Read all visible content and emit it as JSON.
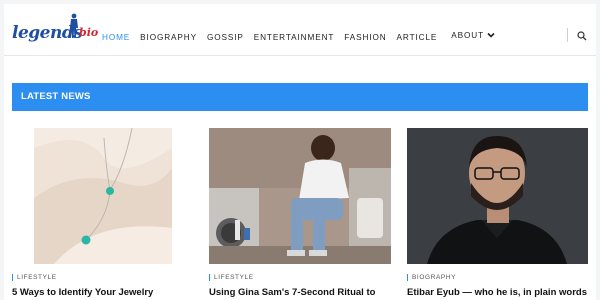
{
  "header": {
    "logo": {
      "word": "legends",
      "suffix": "bio"
    },
    "nav": [
      {
        "label": "HOME",
        "active": true
      },
      {
        "label": "BIOGRAPHY",
        "active": false
      },
      {
        "label": "GOSSIP",
        "active": false
      },
      {
        "label": "ENTERTAINMENT",
        "active": false
      },
      {
        "label": "FASHION",
        "active": false
      },
      {
        "label": "ARTICLE",
        "active": false
      }
    ],
    "about_label": "ABOUT",
    "icons": {
      "search": "search-icon",
      "about_dropdown": "chevron-down-icon"
    }
  },
  "section": {
    "title": "LATEST NEWS"
  },
  "articles": [
    {
      "category": "LIFESTYLE",
      "title": "5 Ways to Identify Your Jewelry"
    },
    {
      "category": "LIFESTYLE",
      "title": "Using Gina Sam's 7-Second Ritual to"
    },
    {
      "category": "BIOGRAPHY",
      "title": "Etibar Eyub — who he is, in plain words"
    }
  ],
  "colors": {
    "accent": "#2d8ef2",
    "logo_blue": "#1f4fa3",
    "logo_red": "#d9232d"
  }
}
